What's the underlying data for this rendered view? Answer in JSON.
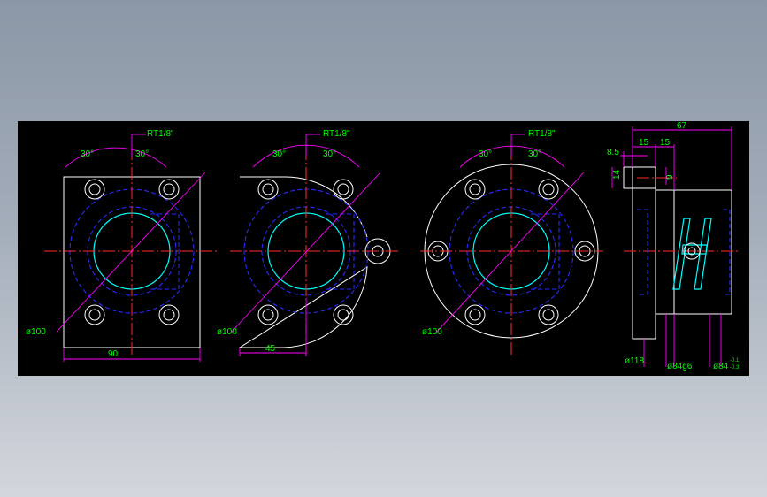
{
  "drawing": {
    "view1": {
      "thread": "RT1/8\"",
      "angle_left": "30°",
      "angle_right": "30°",
      "dia": "ø100",
      "width": "90"
    },
    "view2": {
      "thread": "RT1/8\"",
      "angle_left": "30°",
      "angle_right": "30°",
      "dia": "ø100",
      "offset": "45"
    },
    "view3": {
      "thread": "RT1/8\"",
      "angle_left": "30°",
      "angle_right": "30°",
      "dia": "ø100"
    },
    "side": {
      "length": "67",
      "flange_thk": "15",
      "body_step": "15",
      "small_offset": "8.5",
      "height": "14",
      "hole": "9",
      "dia_flange": "ø118",
      "dia_body": "ø84g6",
      "dia_body2": "ø84",
      "tol_upper": "-0.1",
      "tol_lower": "-0.3"
    }
  },
  "colors": {
    "outline": "#ffffff",
    "hidden": "#2a2aff",
    "centerline": "#ff2a2a",
    "dimension": "#ff00ff",
    "text": "#00ff00",
    "bore": "#00ffff"
  }
}
